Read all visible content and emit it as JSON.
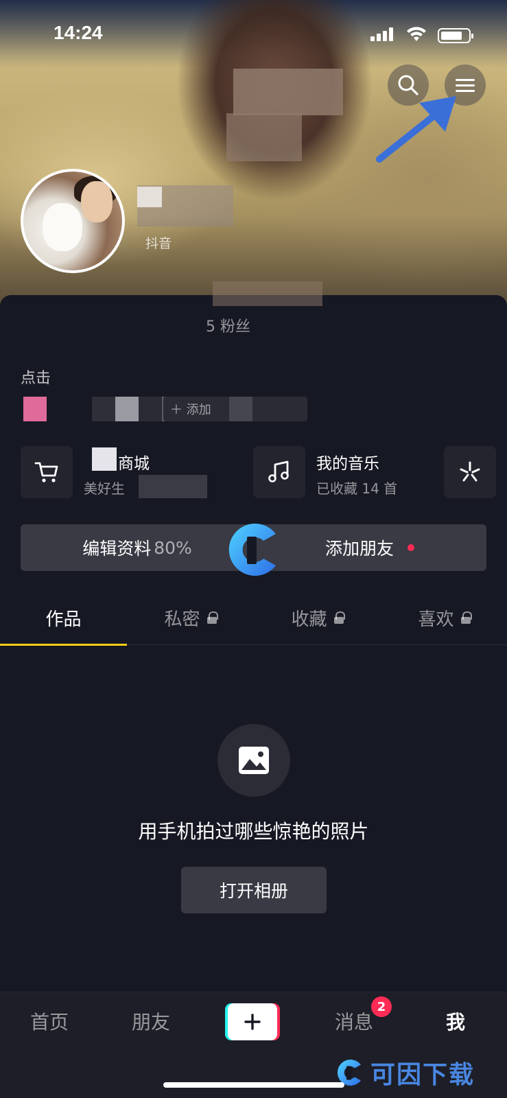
{
  "status_bar": {
    "time": "14:24"
  },
  "header": {
    "account_label": "抖音"
  },
  "profile": {
    "fans_text": "5 粉丝",
    "bio_text": "点击",
    "tag_add_label": "＋ 添加"
  },
  "features": [
    {
      "title": "商城",
      "subtitle": "美好生",
      "icon": "cart-icon"
    },
    {
      "title": "我的音乐",
      "subtitle": "已收藏 14 首",
      "icon": "music-note-icon"
    },
    {
      "title": "",
      "subtitle": "",
      "icon": "sparkle-icon"
    }
  ],
  "actions": {
    "edit_profile": "编辑资料",
    "edit_profile_progress": "80%",
    "add_friends": "添加朋友"
  },
  "tabs": [
    {
      "label": "作品",
      "active": true,
      "locked": false
    },
    {
      "label": "私密",
      "active": false,
      "locked": true
    },
    {
      "label": "收藏",
      "active": false,
      "locked": true
    },
    {
      "label": "喜欢",
      "active": false,
      "locked": true
    }
  ],
  "empty_state": {
    "message": "用手机拍过哪些惊艳的照片",
    "button": "打开相册"
  },
  "bottom_nav": {
    "home": "首页",
    "friends": "朋友",
    "messages": "消息",
    "messages_badge": "2",
    "me": "我"
  },
  "watermark": {
    "text": "可因下载"
  },
  "colors": {
    "background": "#161823",
    "accent_underline": "#face15",
    "badge_red": "#fe2c55",
    "annotation_arrow": "#3b6fd8"
  }
}
